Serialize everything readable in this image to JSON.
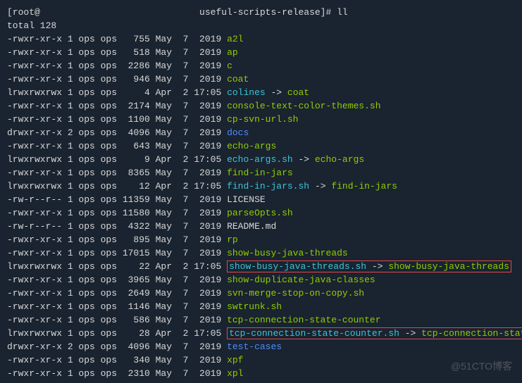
{
  "prompt": {
    "prefix": "[root@",
    "redacted": "                            ",
    "suffix": " useful-scripts-release]# ",
    "cmd": "ll"
  },
  "total_line": "total 128",
  "rows": [
    {
      "perm": "-rwxr-xr-x",
      "links": "1",
      "owner": "ops",
      "group": "ops",
      "size": "755",
      "mon": "May",
      "day": "7",
      "time": "2019",
      "name": "a2l",
      "cls": "green",
      "link": null,
      "link_cls": null,
      "box": false
    },
    {
      "perm": "-rwxr-xr-x",
      "links": "1",
      "owner": "ops",
      "group": "ops",
      "size": "518",
      "mon": "May",
      "day": "7",
      "time": "2019",
      "name": "ap",
      "cls": "green",
      "link": null,
      "link_cls": null,
      "box": false
    },
    {
      "perm": "-rwxr-xr-x",
      "links": "1",
      "owner": "ops",
      "group": "ops",
      "size": "2286",
      "mon": "May",
      "day": "7",
      "time": "2019",
      "name": "c",
      "cls": "green",
      "link": null,
      "link_cls": null,
      "box": false
    },
    {
      "perm": "-rwxr-xr-x",
      "links": "1",
      "owner": "ops",
      "group": "ops",
      "size": "946",
      "mon": "May",
      "day": "7",
      "time": "2019",
      "name": "coat",
      "cls": "green",
      "link": null,
      "link_cls": null,
      "box": false
    },
    {
      "perm": "lrwxrwxrwx",
      "links": "1",
      "owner": "ops",
      "group": "ops",
      "size": "4",
      "mon": "Apr",
      "day": "2",
      "time": "17:05",
      "name": "colines",
      "cls": "cyan",
      "link": "coat",
      "link_cls": "green",
      "box": false
    },
    {
      "perm": "-rwxr-xr-x",
      "links": "1",
      "owner": "ops",
      "group": "ops",
      "size": "2174",
      "mon": "May",
      "day": "7",
      "time": "2019",
      "name": "console-text-color-themes.sh",
      "cls": "green",
      "link": null,
      "link_cls": null,
      "box": false
    },
    {
      "perm": "-rwxr-xr-x",
      "links": "1",
      "owner": "ops",
      "group": "ops",
      "size": "1100",
      "mon": "May",
      "day": "7",
      "time": "2019",
      "name": "cp-svn-url.sh",
      "cls": "green",
      "link": null,
      "link_cls": null,
      "box": false
    },
    {
      "perm": "drwxr-xr-x",
      "links": "2",
      "owner": "ops",
      "group": "ops",
      "size": "4096",
      "mon": "May",
      "day": "7",
      "time": "2019",
      "name": "docs",
      "cls": "blue",
      "link": null,
      "link_cls": null,
      "box": false
    },
    {
      "perm": "-rwxr-xr-x",
      "links": "1",
      "owner": "ops",
      "group": "ops",
      "size": "643",
      "mon": "May",
      "day": "7",
      "time": "2019",
      "name": "echo-args",
      "cls": "green",
      "link": null,
      "link_cls": null,
      "box": false
    },
    {
      "perm": "lrwxrwxrwx",
      "links": "1",
      "owner": "ops",
      "group": "ops",
      "size": "9",
      "mon": "Apr",
      "day": "2",
      "time": "17:05",
      "name": "echo-args.sh",
      "cls": "cyan",
      "link": "echo-args",
      "link_cls": "green",
      "box": false
    },
    {
      "perm": "-rwxr-xr-x",
      "links": "1",
      "owner": "ops",
      "group": "ops",
      "size": "8365",
      "mon": "May",
      "day": "7",
      "time": "2019",
      "name": "find-in-jars",
      "cls": "green",
      "link": null,
      "link_cls": null,
      "box": false
    },
    {
      "perm": "lrwxrwxrwx",
      "links": "1",
      "owner": "ops",
      "group": "ops",
      "size": "12",
      "mon": "Apr",
      "day": "2",
      "time": "17:05",
      "name": "find-in-jars.sh",
      "cls": "cyan",
      "link": "find-in-jars",
      "link_cls": "green",
      "box": false
    },
    {
      "perm": "-rw-r--r--",
      "links": "1",
      "owner": "ops",
      "group": "ops",
      "size": "11359",
      "mon": "May",
      "day": "7",
      "time": "2019",
      "name": "LICENSE",
      "cls": "white",
      "link": null,
      "link_cls": null,
      "box": false
    },
    {
      "perm": "-rwxr-xr-x",
      "links": "1",
      "owner": "ops",
      "group": "ops",
      "size": "11580",
      "mon": "May",
      "day": "7",
      "time": "2019",
      "name": "parseOpts.sh",
      "cls": "green",
      "link": null,
      "link_cls": null,
      "box": false
    },
    {
      "perm": "-rw-r--r--",
      "links": "1",
      "owner": "ops",
      "group": "ops",
      "size": "4322",
      "mon": "May",
      "day": "7",
      "time": "2019",
      "name": "README.md",
      "cls": "white",
      "link": null,
      "link_cls": null,
      "box": false
    },
    {
      "perm": "-rwxr-xr-x",
      "links": "1",
      "owner": "ops",
      "group": "ops",
      "size": "895",
      "mon": "May",
      "day": "7",
      "time": "2019",
      "name": "rp",
      "cls": "green",
      "link": null,
      "link_cls": null,
      "box": false
    },
    {
      "perm": "-rwxr-xr-x",
      "links": "1",
      "owner": "ops",
      "group": "ops",
      "size": "17015",
      "mon": "May",
      "day": "7",
      "time": "2019",
      "name": "show-busy-java-threads",
      "cls": "green",
      "link": null,
      "link_cls": null,
      "box": false
    },
    {
      "perm": "lrwxrwxrwx",
      "links": "1",
      "owner": "ops",
      "group": "ops",
      "size": "22",
      "mon": "Apr",
      "day": "2",
      "time": "17:05",
      "name": "show-busy-java-threads.sh",
      "cls": "cyan",
      "link": "show-busy-java-threads",
      "link_cls": "green",
      "box": true
    },
    {
      "perm": "-rwxr-xr-x",
      "links": "1",
      "owner": "ops",
      "group": "ops",
      "size": "3965",
      "mon": "May",
      "day": "7",
      "time": "2019",
      "name": "show-duplicate-java-classes",
      "cls": "green",
      "link": null,
      "link_cls": null,
      "box": false
    },
    {
      "perm": "-rwxr-xr-x",
      "links": "1",
      "owner": "ops",
      "group": "ops",
      "size": "2649",
      "mon": "May",
      "day": "7",
      "time": "2019",
      "name": "svn-merge-stop-on-copy.sh",
      "cls": "green",
      "link": null,
      "link_cls": null,
      "box": false
    },
    {
      "perm": "-rwxr-xr-x",
      "links": "1",
      "owner": "ops",
      "group": "ops",
      "size": "1146",
      "mon": "May",
      "day": "7",
      "time": "2019",
      "name": "swtrunk.sh",
      "cls": "green",
      "link": null,
      "link_cls": null,
      "box": false
    },
    {
      "perm": "-rwxr-xr-x",
      "links": "1",
      "owner": "ops",
      "group": "ops",
      "size": "586",
      "mon": "May",
      "day": "7",
      "time": "2019",
      "name": "tcp-connection-state-counter",
      "cls": "green",
      "link": null,
      "link_cls": null,
      "box": false
    },
    {
      "perm": "lrwxrwxrwx",
      "links": "1",
      "owner": "ops",
      "group": "ops",
      "size": "28",
      "mon": "Apr",
      "day": "2",
      "time": "17:05",
      "name": "tcp-connection-state-counter.sh",
      "cls": "cyan",
      "link": "tcp-connection-state-counter",
      "link_cls": "green",
      "box": true
    },
    {
      "perm": "drwxr-xr-x",
      "links": "2",
      "owner": "ops",
      "group": "ops",
      "size": "4096",
      "mon": "May",
      "day": "7",
      "time": "2019",
      "name": "test-cases",
      "cls": "blue",
      "link": null,
      "link_cls": null,
      "box": false
    },
    {
      "perm": "-rwxr-xr-x",
      "links": "1",
      "owner": "ops",
      "group": "ops",
      "size": "340",
      "mon": "May",
      "day": "7",
      "time": "2019",
      "name": "xpf",
      "cls": "green",
      "link": null,
      "link_cls": null,
      "box": false
    },
    {
      "perm": "-rwxr-xr-x",
      "links": "1",
      "owner": "ops",
      "group": "ops",
      "size": "2310",
      "mon": "May",
      "day": "7",
      "time": "2019",
      "name": "xpl",
      "cls": "green",
      "link": null,
      "link_cls": null,
      "box": false
    }
  ],
  "arrow": " -> ",
  "watermark": "@51CTO博客"
}
